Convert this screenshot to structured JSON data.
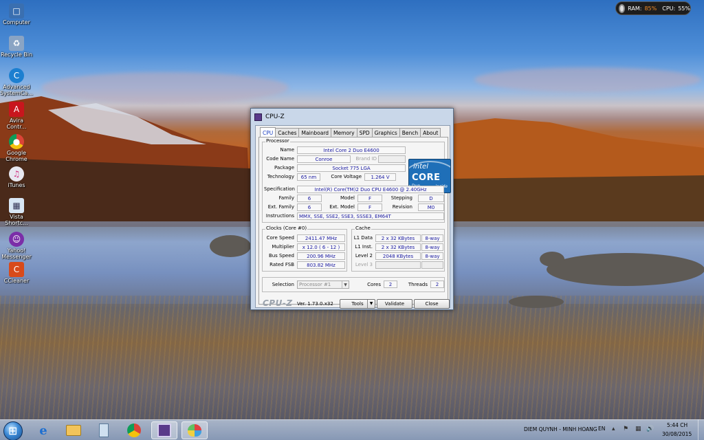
{
  "desktop": {
    "icons": [
      {
        "label": "Computer",
        "icon": "computer-icon"
      },
      {
        "label": "Recycle Bin",
        "icon": "recycle-bin-icon"
      },
      {
        "label": "Advanced SystemCa...",
        "icon": "advanced-systemcare-icon"
      },
      {
        "label": "Avira Contr...",
        "icon": "avira-icon"
      },
      {
        "label": "Google Chrome",
        "icon": "chrome-icon"
      },
      {
        "label": "iTunes",
        "icon": "itunes-icon"
      },
      {
        "label": "Vista Shortc...",
        "icon": "vista-shortcut-icon"
      },
      {
        "label": "Yahoo! Messenger",
        "icon": "yahoo-messenger-icon"
      },
      {
        "label": "CCleaner",
        "icon": "ccleaner-icon"
      }
    ]
  },
  "gadget": {
    "ram_label": "RAM:",
    "ram_value": "85%",
    "cpu_label": "CPU:",
    "cpu_value": "55%"
  },
  "cpuz": {
    "title": "CPU-Z",
    "tabs": [
      "CPU",
      "Caches",
      "Mainboard",
      "Memory",
      "SPD",
      "Graphics",
      "Bench",
      "About"
    ],
    "active_tab": "CPU",
    "processor": {
      "group_label": "Processor",
      "name_label": "Name",
      "name": "Intel Core 2 Duo E4600",
      "codename_label": "Code Name",
      "codename": "Conroe",
      "brandid_label": "Brand ID",
      "brandid": "",
      "package_label": "Package",
      "package": "Socket 775 LGA",
      "technology_label": "Technology",
      "technology": "65 nm",
      "corevoltage_label": "Core Voltage",
      "corevoltage": "1.264 V",
      "specification_label": "Specification",
      "specification": "Intel(R) Core(TM)2 Duo CPU     E4600  @ 2.40GHz",
      "family_label": "Family",
      "family": "6",
      "model_label": "Model",
      "model": "F",
      "stepping_label": "Stepping",
      "stepping": "D",
      "extfamily_label": "Ext. Family",
      "extfamily": "6",
      "extmodel_label": "Ext. Model",
      "extmodel": "F",
      "revision_label": "Revision",
      "revision": "M0",
      "instructions_label": "Instructions",
      "instructions": "MMX, SSE, SSE2, SSE3, SSSE3, EM64T",
      "logo": {
        "line1": "intel",
        "line2": "CORE",
        "line3": "Duo",
        "line4": "inside"
      }
    },
    "clocks": {
      "group_label": "Clocks (Core #0)",
      "corespeed_label": "Core Speed",
      "corespeed": "2411.47 MHz",
      "multiplier_label": "Multiplier",
      "multiplier": "x 12.0 ( 6 - 12 )",
      "busspeed_label": "Bus Speed",
      "busspeed": "200.96 MHz",
      "ratedfsb_label": "Rated FSB",
      "ratedfsb": "803.82 MHz"
    },
    "cache": {
      "group_label": "Cache",
      "l1data_label": "L1 Data",
      "l1data": "2 x 32 KBytes",
      "l1data_way": "8-way",
      "l1inst_label": "L1 Inst.",
      "l1inst": "2 x 32 KBytes",
      "l1inst_way": "8-way",
      "level2_label": "Level 2",
      "level2": "2048 KBytes",
      "level2_way": "8-way",
      "level3_label": "Level 3"
    },
    "selection": {
      "label": "Selection",
      "value": "Processor #1",
      "cores_label": "Cores",
      "cores": "2",
      "threads_label": "Threads",
      "threads": "2"
    },
    "footer": {
      "brand": "CPU-Z",
      "version": "Ver. 1.73.0.x32",
      "tools_label": "Tools",
      "validate_label": "Validate",
      "close_label": "Close"
    }
  },
  "taskbar": {
    "items": [
      {
        "icon": "internet-explorer-icon"
      },
      {
        "icon": "file-explorer-icon"
      },
      {
        "icon": "calculator-icon"
      },
      {
        "icon": "chrome-icon"
      },
      {
        "icon": "cpuz-icon"
      },
      {
        "icon": "paint-icon"
      }
    ],
    "now_playing": "DIEM QUYNH - MINH HOANG",
    "language": "EN",
    "time": "5:44 CH",
    "date": "30/08/2015"
  }
}
